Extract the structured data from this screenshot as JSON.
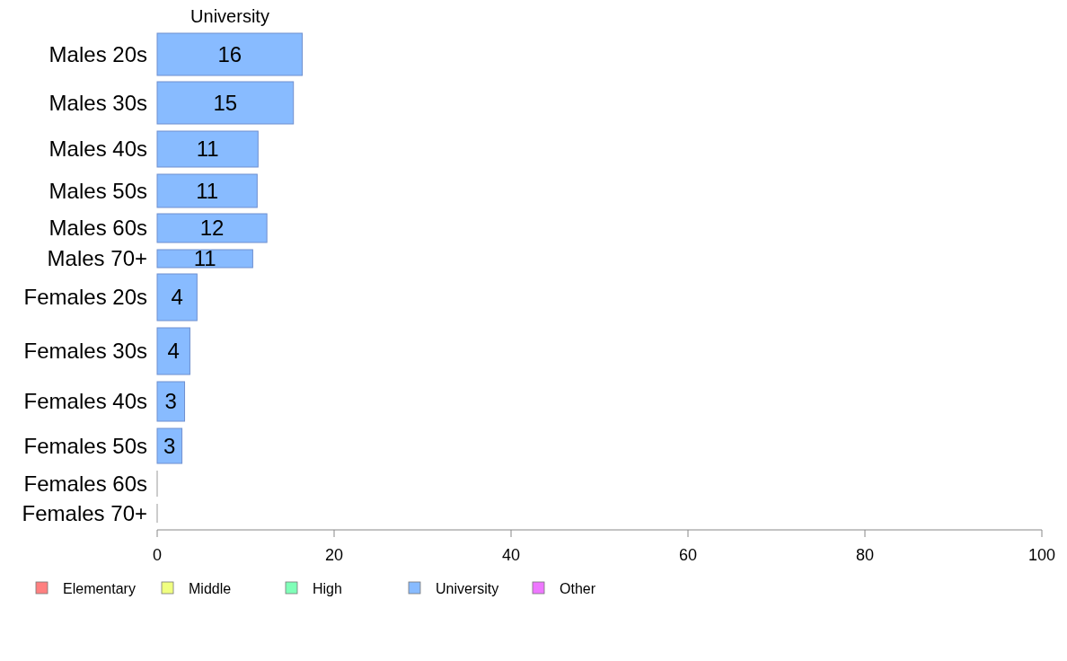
{
  "chart": {
    "chart_data": {
      "type": "bar",
      "orientation": "horizontal",
      "stacked": true,
      "title": "University",
      "categories": [
        "Males 20s",
        "Males 30s",
        "Males 40s",
        "Males 50s",
        "Males 60s",
        "Males 70+",
        "Females 20s",
        "Females 30s",
        "Females 40s",
        "Females 50s",
        "Females 60s",
        "Females 70+"
      ],
      "xlim": [
        0,
        100
      ],
      "xticks": [
        0,
        20,
        40,
        60,
        80,
        100
      ],
      "series": [
        {
          "name": "Elementary",
          "color": "#ff8080",
          "values": [
            0,
            0,
            0,
            0,
            0,
            0,
            0,
            0,
            0,
            0,
            0,
            0
          ]
        },
        {
          "name": "Middle",
          "color": "#f0ff80",
          "values": [
            0,
            0,
            0,
            0,
            0,
            0,
            0,
            0,
            0,
            0,
            0,
            0
          ]
        },
        {
          "name": "High",
          "color": "#80ffb8",
          "values": [
            0,
            0,
            0,
            0,
            0,
            0,
            0,
            0,
            0,
            0,
            0,
            0
          ]
        },
        {
          "name": "University",
          "color": "#88bbff",
          "values": [
            16.4,
            15.4,
            11.4,
            11.3,
            12.4,
            10.8,
            4.5,
            3.7,
            3.1,
            2.8,
            0,
            0
          ]
        },
        {
          "name": "Other",
          "color": "#ee77ff",
          "values": [
            0,
            0,
            0,
            0,
            0,
            0,
            0,
            0,
            0,
            0,
            0,
            0
          ]
        }
      ],
      "value_labels": [
        "16",
        "15",
        "11",
        "11",
        "12",
        "11",
        "4",
        "4",
        "3",
        "3",
        null,
        null
      ]
    }
  }
}
